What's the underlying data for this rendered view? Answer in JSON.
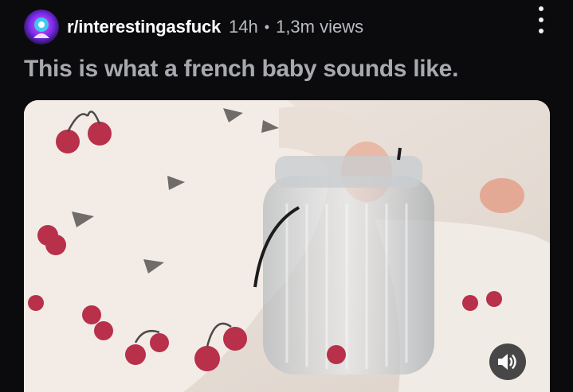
{
  "post": {
    "subreddit": "r/interestingasfuck",
    "age": "14h",
    "separator": "•",
    "views": "1,3m views",
    "title": "This is what a french baby sounds like."
  },
  "icons": {
    "more": "kebab-vertical-icon",
    "sound": "volume-icon",
    "avatar": "subreddit-avatar-icon"
  },
  "colors": {
    "background": "#0b0b0e",
    "subreddit_text": "#ffffff",
    "meta_text": "#b9bcc2",
    "title_text": "#a7a9ae"
  }
}
